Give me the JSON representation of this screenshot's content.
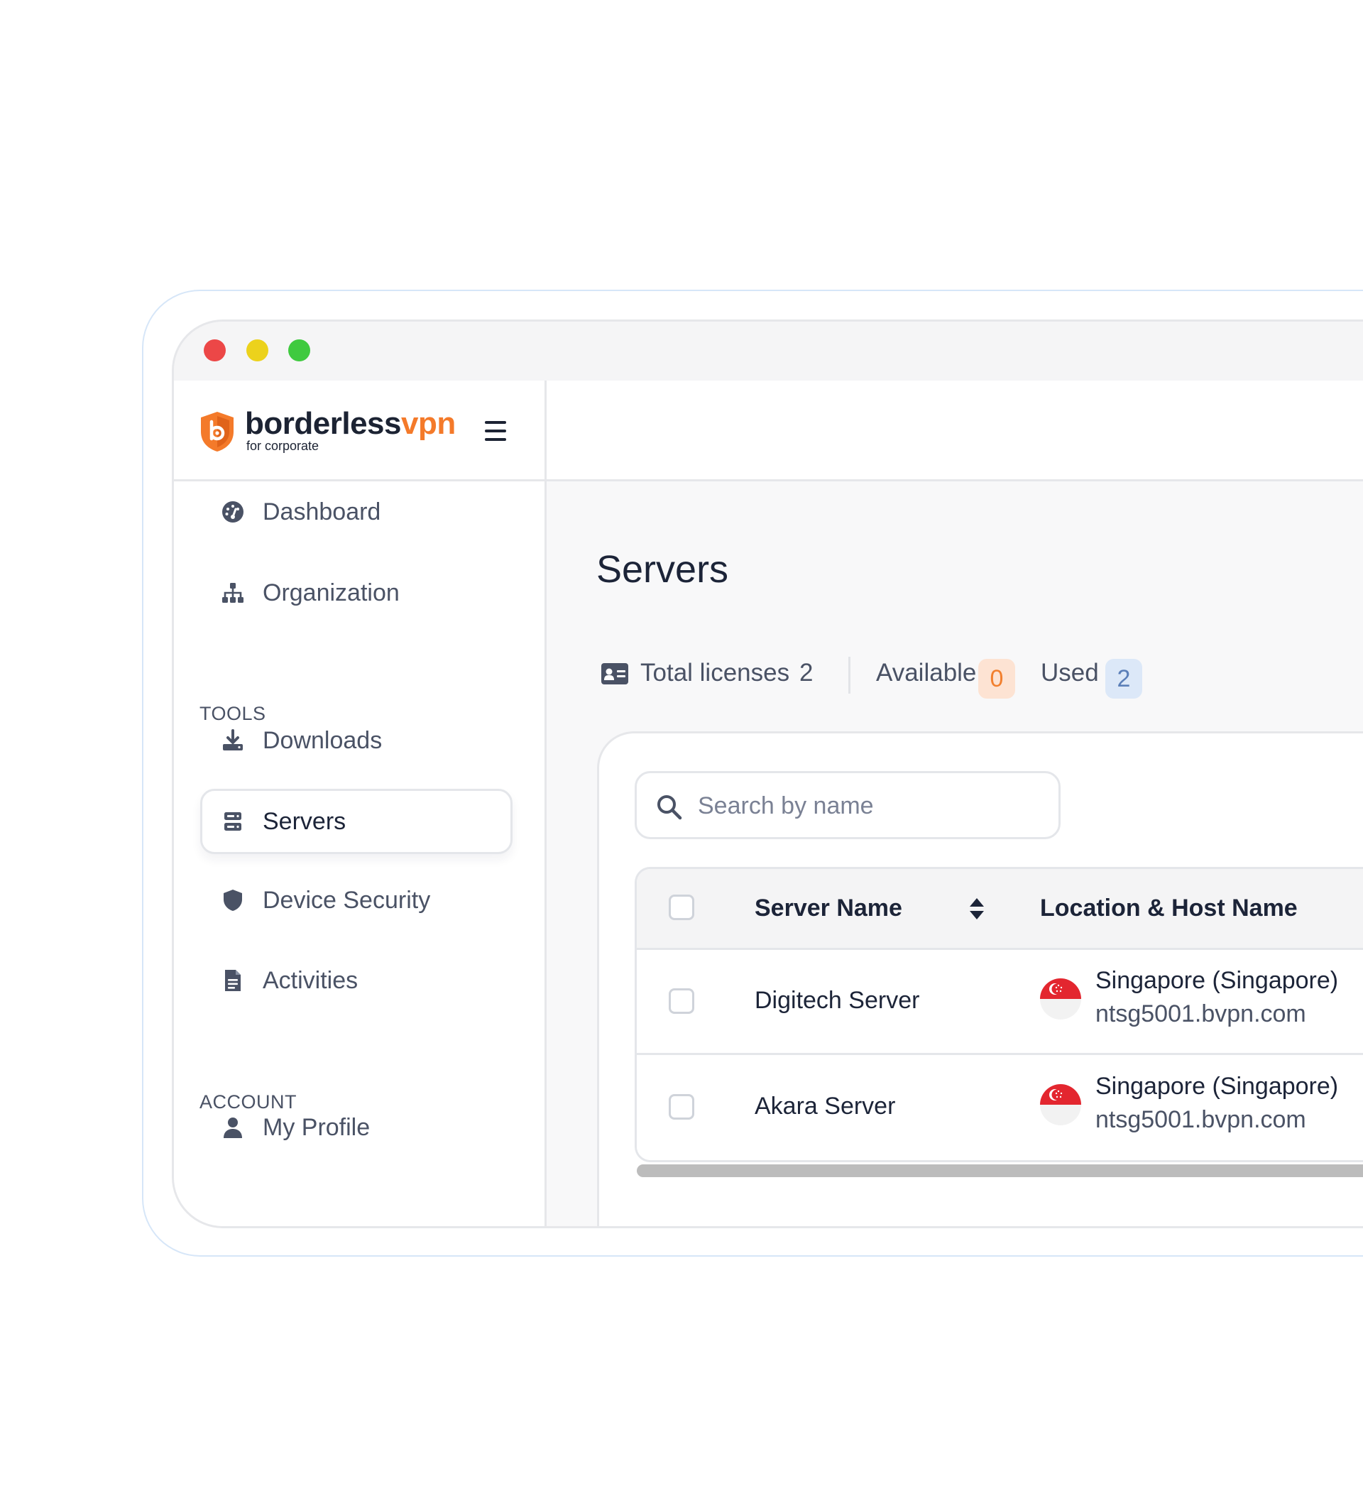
{
  "brand": {
    "name_main": "borderless",
    "name_accent": "vpn",
    "tagline": "for corporate",
    "accent_color": "#f47a2a"
  },
  "window_controls": {
    "close_color": "#ec4747",
    "minimize_color": "#ecd21c",
    "maximize_color": "#3fca3f"
  },
  "sidebar": {
    "items": [
      {
        "label": "Dashboard",
        "icon": "dashboard-gauge-icon"
      },
      {
        "label": "Organization",
        "icon": "sitemap-icon"
      }
    ],
    "tools_heading": "TOOLS",
    "tools": [
      {
        "label": "Downloads",
        "icon": "download-icon"
      },
      {
        "label": "Servers",
        "icon": "server-icon",
        "active": true
      },
      {
        "label": "Device Security",
        "icon": "shield-icon"
      },
      {
        "label": "Activities",
        "icon": "document-icon"
      }
    ],
    "account_heading": "ACCOUNT",
    "account": [
      {
        "label": "My Profile",
        "icon": "user-icon"
      }
    ]
  },
  "main": {
    "title": "Servers",
    "licenses": {
      "total_label": "Total licenses",
      "total_value": "2",
      "available_label": "Available",
      "available_value": "0",
      "used_label": "Used",
      "used_value": "2"
    },
    "search": {
      "placeholder": "Search by name"
    },
    "table": {
      "columns": [
        "Server Name",
        "Location & Host Name"
      ],
      "rows": [
        {
          "name": "Digitech Server",
          "location": "Singapore (Singapore)",
          "host": "ntsg5001.bvpn.com",
          "flag": "singapore-flag-icon"
        },
        {
          "name": "Akara Server",
          "location": "Singapore (Singapore)",
          "host": "ntsg5001.bvpn.com",
          "flag": "singapore-flag-icon"
        }
      ]
    }
  }
}
